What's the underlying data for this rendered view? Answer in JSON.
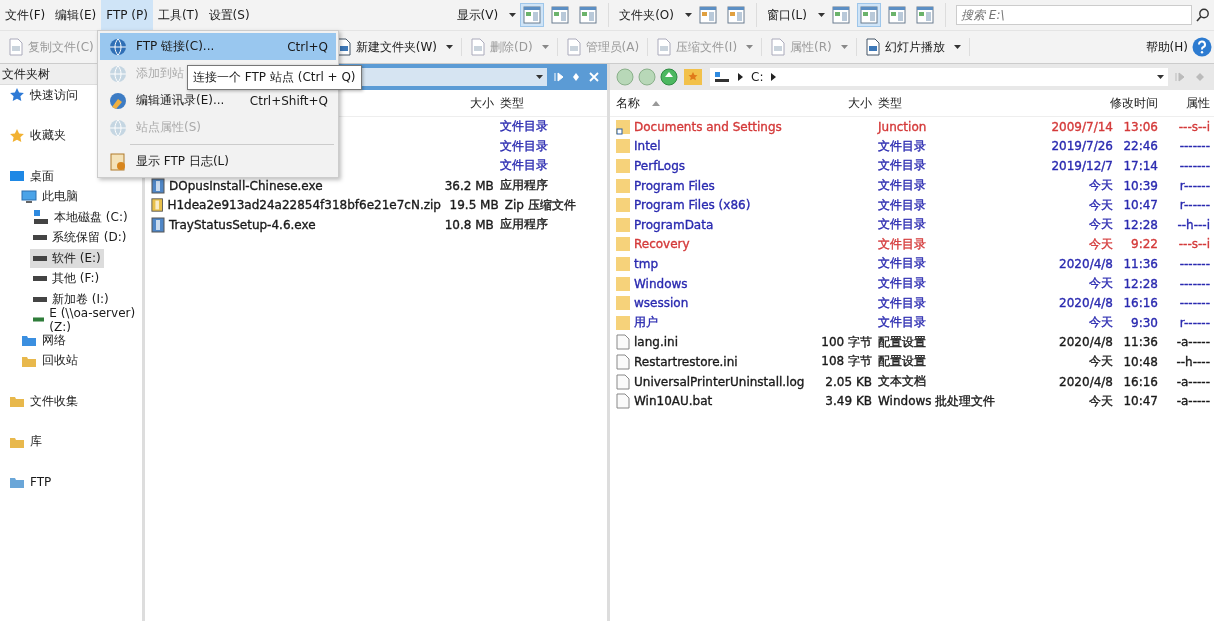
{
  "menu_bar": [
    {
      "label": "文件(F)",
      "selected": false
    },
    {
      "label": "编辑(E)",
      "selected": false
    },
    {
      "label": "FTP (P)",
      "selected": true
    },
    {
      "label": "工具(T)",
      "selected": false
    },
    {
      "label": "设置(S)",
      "selected": false
    }
  ],
  "view_groups": [
    {
      "label": "显示(V)",
      "buttons": [
        {
          "selected": true
        },
        {
          "selected": false
        },
        {
          "selected": false
        }
      ]
    },
    {
      "label": "文件夹(O)",
      "buttons": [
        {
          "selected": false
        },
        {
          "selected": false
        }
      ]
    },
    {
      "label": "窗口(L)",
      "buttons": [
        {
          "selected": false
        },
        {
          "selected": true
        },
        {
          "selected": false
        },
        {
          "selected": false
        }
      ]
    }
  ],
  "search": {
    "placeholder": "搜索 E:\\"
  },
  "toolbar": [
    {
      "label": "复制文件(C)",
      "disabled": true,
      "dropdown": false
    },
    {
      "label": "新建文件夹(W)",
      "disabled": false,
      "dropdown": true
    },
    {
      "label": "删除(D)",
      "disabled": true,
      "dropdown": true
    },
    {
      "label": "管理员(A)",
      "disabled": true,
      "dropdown": false
    },
    {
      "label": "压缩文件(I)",
      "disabled": true,
      "dropdown": true
    },
    {
      "label": "属性(R)",
      "disabled": true,
      "dropdown": true
    },
    {
      "label": "幻灯片播放",
      "disabled": false,
      "dropdown": true
    }
  ],
  "help": {
    "label": "帮助(H)"
  },
  "tree": {
    "title": "文件夹树",
    "sections": [
      [
        {
          "label": "快速访问",
          "kind": "pin",
          "selected": false
        }
      ],
      [
        {
          "label": "收藏夹",
          "kind": "star",
          "selected": false
        }
      ],
      [
        {
          "label": "桌面",
          "kind": "desktop",
          "selected": false,
          "children": [
            {
              "label": "此电脑",
              "kind": "pc",
              "selected": false,
              "children": [
                {
                  "label": "本地磁盘 (C:)",
                  "kind": "sysdrive",
                  "selected": false
                },
                {
                  "label": "系统保留 (D:)",
                  "kind": "drive",
                  "selected": false
                },
                {
                  "label": "软件 (E:)",
                  "kind": "drive",
                  "selected": true
                },
                {
                  "label": "其他 (F:)",
                  "kind": "drive",
                  "selected": false
                },
                {
                  "label": "新加卷 (I:)",
                  "kind": "drive",
                  "selected": false
                },
                {
                  "label": "E (\\\\oa-server) (Z:)",
                  "kind": "netdrive",
                  "selected": false
                }
              ]
            },
            {
              "label": "网络",
              "kind": "network",
              "selected": false
            },
            {
              "label": "回收站",
              "kind": "bin",
              "selected": false
            }
          ]
        }
      ],
      [
        {
          "label": "文件收集",
          "kind": "collect",
          "selected": false
        }
      ],
      [
        {
          "label": "库",
          "kind": "library",
          "selected": false
        }
      ],
      [
        {
          "label": "FTP",
          "kind": "ftp",
          "selected": false
        }
      ]
    ]
  },
  "left_pane": {
    "columns": [
      "大小",
      "类型"
    ],
    "rows": [
      {
        "type": "文件目录",
        "color": "#2a2ab0"
      },
      {
        "type": "文件目录",
        "color": "#2a2ab0"
      },
      {
        "type": "文件目录",
        "color": "#2a2ab0"
      },
      {
        "kind": "exe",
        "name": "DOpusInstall-Chinese.exe",
        "size": "36.2 MB",
        "type": "应用程序",
        "color": "#1a1a1a"
      },
      {
        "kind": "zip",
        "name": "H1dea2e913ad24a22854f318bf6e21e7cN.zip",
        "size": "19.5 MB",
        "type": "Zip 压缩文件",
        "color": "#1a1a1a"
      },
      {
        "kind": "exe",
        "name": "TrayStatusSetup-4.6.exe",
        "size": "10.8 MB",
        "type": "应用程序",
        "color": "#1a1a1a"
      }
    ]
  },
  "right_pane": {
    "path": "C:",
    "columns": [
      "名称",
      "大小",
      "类型",
      "修改时间",
      "属性"
    ],
    "rows": [
      {
        "kind": "link",
        "name": "Documents and Settings",
        "type": "Junction",
        "date": "2009/7/14",
        "time": "13:06",
        "attr": "---s--i",
        "color": "#d43a3a"
      },
      {
        "kind": "folder",
        "name": "Intel",
        "type": "文件目录",
        "date": "2019/7/26",
        "time": "22:46",
        "attr": "-------",
        "color": "#2a2ab0"
      },
      {
        "kind": "folder",
        "name": "PerfLogs",
        "type": "文件目录",
        "date": "2019/12/7",
        "time": "17:14",
        "attr": "-------",
        "color": "#2a2ab0"
      },
      {
        "kind": "folder",
        "name": "Program Files",
        "type": "文件目录",
        "date": "今天",
        "time": "10:39",
        "attr": "r------",
        "color": "#2a2ab0"
      },
      {
        "kind": "folder",
        "name": "Program Files (x86)",
        "type": "文件目录",
        "date": "今天",
        "time": "10:47",
        "attr": "r------",
        "color": "#2a2ab0"
      },
      {
        "kind": "folder",
        "name": "ProgramData",
        "type": "文件目录",
        "date": "今天",
        "time": "12:28",
        "attr": "--h---i",
        "color": "#2a2ab0"
      },
      {
        "kind": "folder",
        "name": "Recovery",
        "type": "文件目录",
        "date": "今天",
        "time": "9:22",
        "attr": "---s--i",
        "color": "#d43a3a"
      },
      {
        "kind": "folder",
        "name": "tmp",
        "type": "文件目录",
        "date": "2020/4/8",
        "time": "11:36",
        "attr": "-------",
        "color": "#2a2ab0"
      },
      {
        "kind": "folder",
        "name": "Windows",
        "type": "文件目录",
        "date": "今天",
        "time": "12:28",
        "attr": "-------",
        "color": "#2a2ab0"
      },
      {
        "kind": "folder",
        "name": "wsession",
        "type": "文件目录",
        "date": "2020/4/8",
        "time": "16:16",
        "attr": "-------",
        "color": "#2a2ab0"
      },
      {
        "kind": "folder",
        "name": "用户",
        "type": "文件目录",
        "date": "今天",
        "time": "9:30",
        "attr": "r------",
        "color": "#2a2ab0"
      },
      {
        "kind": "file",
        "name": "lang.ini",
        "size": "100 字节",
        "type": "配置设置",
        "date": "2020/4/8",
        "time": "11:36",
        "attr": "-a-----",
        "color": "#1a1a1a"
      },
      {
        "kind": "file",
        "name": "Restartrestore.ini",
        "size": "108 字节",
        "type": "配置设置",
        "date": "今天",
        "time": "10:48",
        "attr": "--h----",
        "color": "#1a1a1a"
      },
      {
        "kind": "file",
        "name": "UniversalPrinterUninstall.log",
        "size": "2.05 KB",
        "type": "文本文档",
        "date": "2020/4/8",
        "time": "16:16",
        "attr": "-a-----",
        "color": "#1a1a1a"
      },
      {
        "kind": "file",
        "name": "Win10AU.bat",
        "size": "3.49 KB",
        "type": "Windows 批处理文件",
        "date": "今天",
        "time": "10:47",
        "attr": "-a-----",
        "color": "#1a1a1a"
      }
    ]
  },
  "ftp_menu": {
    "items": [
      {
        "kind": "item",
        "label": "FTP 链接(C)...",
        "shortcut": "Ctrl+Q",
        "selected": true,
        "disabled": false
      },
      {
        "kind": "item",
        "label": "添加到站",
        "selected": false,
        "disabled": true
      },
      {
        "kind": "item",
        "label": "编辑通讯录(E)...",
        "shortcut": "Ctrl+Shift+Q",
        "selected": false,
        "disabled": false
      },
      {
        "kind": "item",
        "label": "站点属性(S)",
        "selected": false,
        "disabled": true
      },
      {
        "kind": "separator"
      },
      {
        "kind": "item",
        "label": "显示 FTP 日志(L)",
        "selected": false,
        "disabled": false
      }
    ]
  },
  "tooltip": "连接一个 FTP 站点 (Ctrl + Q)"
}
